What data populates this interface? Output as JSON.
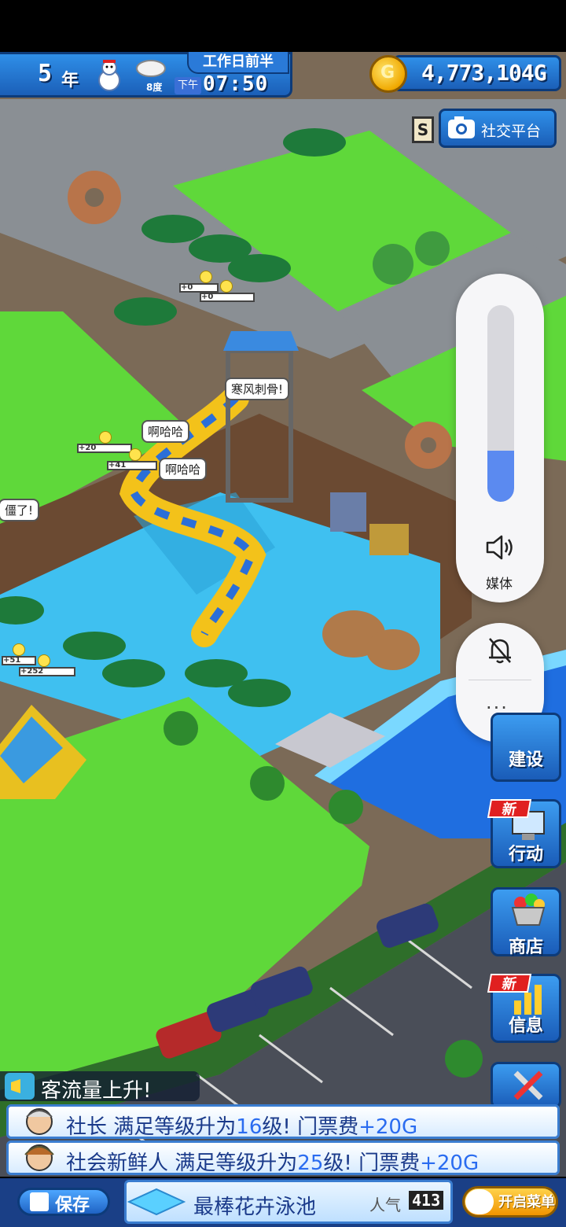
{
  "hud": {
    "year": "5",
    "year_unit": "年",
    "weather": "cloud-icon",
    "temperature": "8度",
    "ampm": "下午",
    "time": "07:50",
    "period": "工作日前半",
    "money": "4,773,104",
    "money_unit": "G",
    "social_badge": "S",
    "social_label": "社交平台"
  },
  "scene": {
    "bubbles": [
      "寒风刺骨!",
      "啊哈哈",
      "啊哈哈",
      "僵了!"
    ],
    "stats": [
      "+0",
      "+0",
      "+20",
      "+41",
      "+51",
      "+252"
    ]
  },
  "volume": {
    "level": 0.26,
    "label": "媒体"
  },
  "side_buttons": [
    {
      "label": "建设",
      "new": false
    },
    {
      "label": "行动",
      "new": true
    },
    {
      "label": "商店",
      "new": false
    },
    {
      "label": "信息",
      "new": true
    },
    {
      "label": "设置",
      "new": false
    }
  ],
  "new_tag": "新",
  "notifications": {
    "small": "客流量上升!",
    "messages": [
      {
        "name": "社长",
        "pre": "满足等级升为",
        "level": "16",
        "mid": "级!  门票费",
        "fee": "+20G"
      },
      {
        "name": "社会新鲜人",
        "pre": "满足等级升为",
        "level": "25",
        "mid": "级!  门票费",
        "fee": "+20G"
      }
    ]
  },
  "bottom": {
    "save_label": "保存",
    "title": "最棒花卉泳池",
    "popularity_label": "人气",
    "popularity": "413",
    "menu_label": "开启菜单"
  },
  "colors": {
    "hud_blue": "#2f8fe8",
    "grass": "#5fd83a",
    "water": "#3fc0f0",
    "deep_water": "#1f6ee0",
    "volume_fill": "#5b8af0"
  }
}
